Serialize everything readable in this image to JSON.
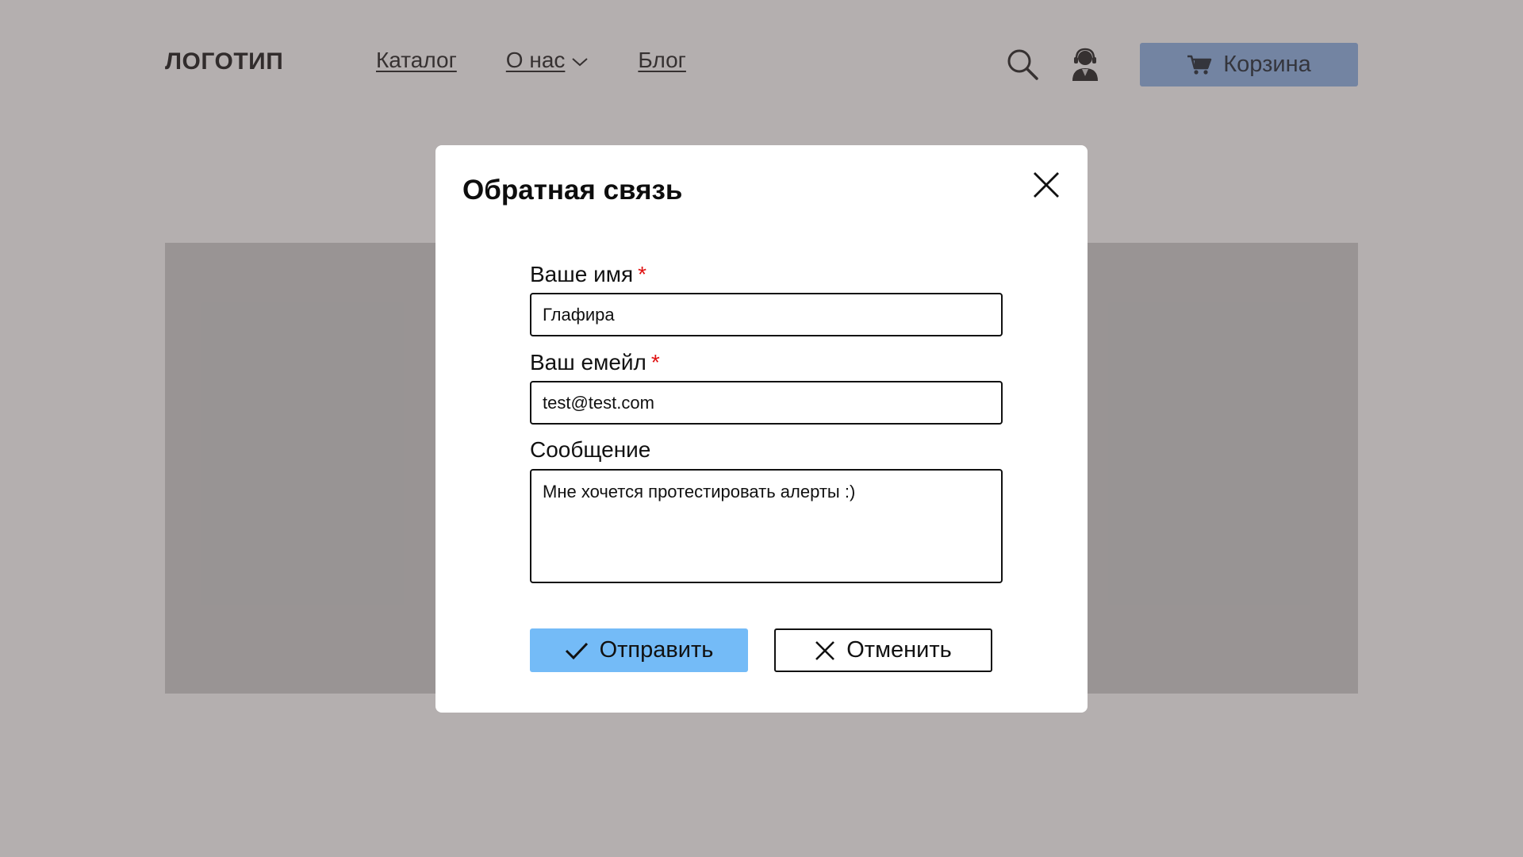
{
  "header": {
    "logo": "ЛОГОТИП",
    "nav": [
      {
        "label": "Каталог"
      },
      {
        "label": "О нас"
      },
      {
        "label": "Блог"
      }
    ],
    "cart_label": "Корзина",
    "icons": [
      "search-icon",
      "support-icon",
      "cart-icon"
    ]
  },
  "modal": {
    "title": "Обратная связь",
    "fields": {
      "name": {
        "label": "Ваше имя",
        "required": "*",
        "value": "Глафира"
      },
      "email": {
        "label": "Ваш емейл",
        "required": "*",
        "value": "test@test.com"
      },
      "message": {
        "label": "Сообщение",
        "value": "Мне хочется протестировать алерты :)"
      }
    },
    "submit_label": "Отправить",
    "cancel_label": "Отменить"
  },
  "colors": {
    "accent": "#74bbf7",
    "cart_button": "#8db3e8",
    "required": "#e01010",
    "overlay": "rgba(80,70,70,0.43)"
  }
}
